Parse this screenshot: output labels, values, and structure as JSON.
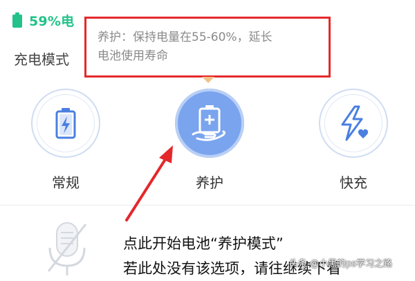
{
  "status": {
    "battery_text": "59%电",
    "battery_icon": "battery-icon",
    "accent": "#22c28a"
  },
  "section": {
    "title": "充电模式"
  },
  "tooltip": {
    "line1": "养护：保持电量在55-60%，延长",
    "line2": "电池使用寿命",
    "border_color": "#e4282c"
  },
  "modes": [
    {
      "label": "常规",
      "icon": "battery-bolt-icon",
      "selected": false
    },
    {
      "label": "养护",
      "icon": "battery-care-icon",
      "selected": true
    },
    {
      "label": "快充",
      "icon": "fast-charge-icon",
      "selected": false
    }
  ],
  "annotation": {
    "line1": "点此开始电池“养护模式”",
    "line2": "若此处没有该选项，请往继续下看"
  },
  "watermark": {
    "text": "头条 @小黑的ps学习之路"
  },
  "colors": {
    "arrow": "#e4282c",
    "active_circle": "#7aa4ee",
    "icon_blue": "#4a7fe0"
  }
}
